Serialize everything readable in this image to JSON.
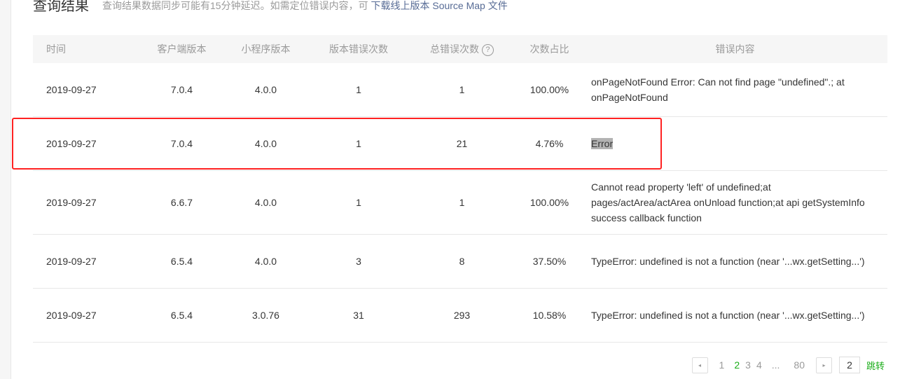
{
  "title": "查询结果",
  "description": "查询结果数据同步可能有15分钟延迟。如需定位错误内容，可 ",
  "download_link": "下载线上版本 Source Map 文件",
  "columns": [
    "时间",
    "客户端版本",
    "小程序版本",
    "版本错误次数",
    "总错误次数",
    "次数占比",
    "错误内容"
  ],
  "help_icon": "?",
  "rows": [
    {
      "time": "2019-09-27",
      "client": "7.0.4",
      "mini": "4.0.0",
      "ver_err": "1",
      "total": "1",
      "ratio": "100.00%",
      "content": "onPageNotFound Error: Can not find page \"undefined\".; at onPageNotFound"
    },
    {
      "time": "2019-09-27",
      "client": "7.0.4",
      "mini": "4.0.0",
      "ver_err": "1",
      "total": "21",
      "ratio": "4.76%",
      "content": "Error"
    },
    {
      "time": "2019-09-27",
      "client": "6.6.7",
      "mini": "4.0.0",
      "ver_err": "1",
      "total": "1",
      "ratio": "100.00%",
      "content": "Cannot read property 'left' of undefined;at pages/actArea/actArea onUnload function;at api getSystemInfo success callback function"
    },
    {
      "time": "2019-09-27",
      "client": "6.5.4",
      "mini": "4.0.0",
      "ver_err": "3",
      "total": "8",
      "ratio": "37.50%",
      "content": "TypeError: undefined is not a function (near '...wx.getSetting...')"
    },
    {
      "time": "2019-09-27",
      "client": "6.5.4",
      "mini": "3.0.76",
      "ver_err": "31",
      "total": "293",
      "ratio": "10.58%",
      "content": "TypeError: undefined is not a function (near '...wx.getSetting...')"
    }
  ],
  "pagination": {
    "pages": [
      "1",
      "2",
      "3",
      "4",
      "...",
      "80"
    ],
    "current": "2",
    "input": "2",
    "go": "跳转",
    "prev": "◂",
    "next": "▸"
  }
}
